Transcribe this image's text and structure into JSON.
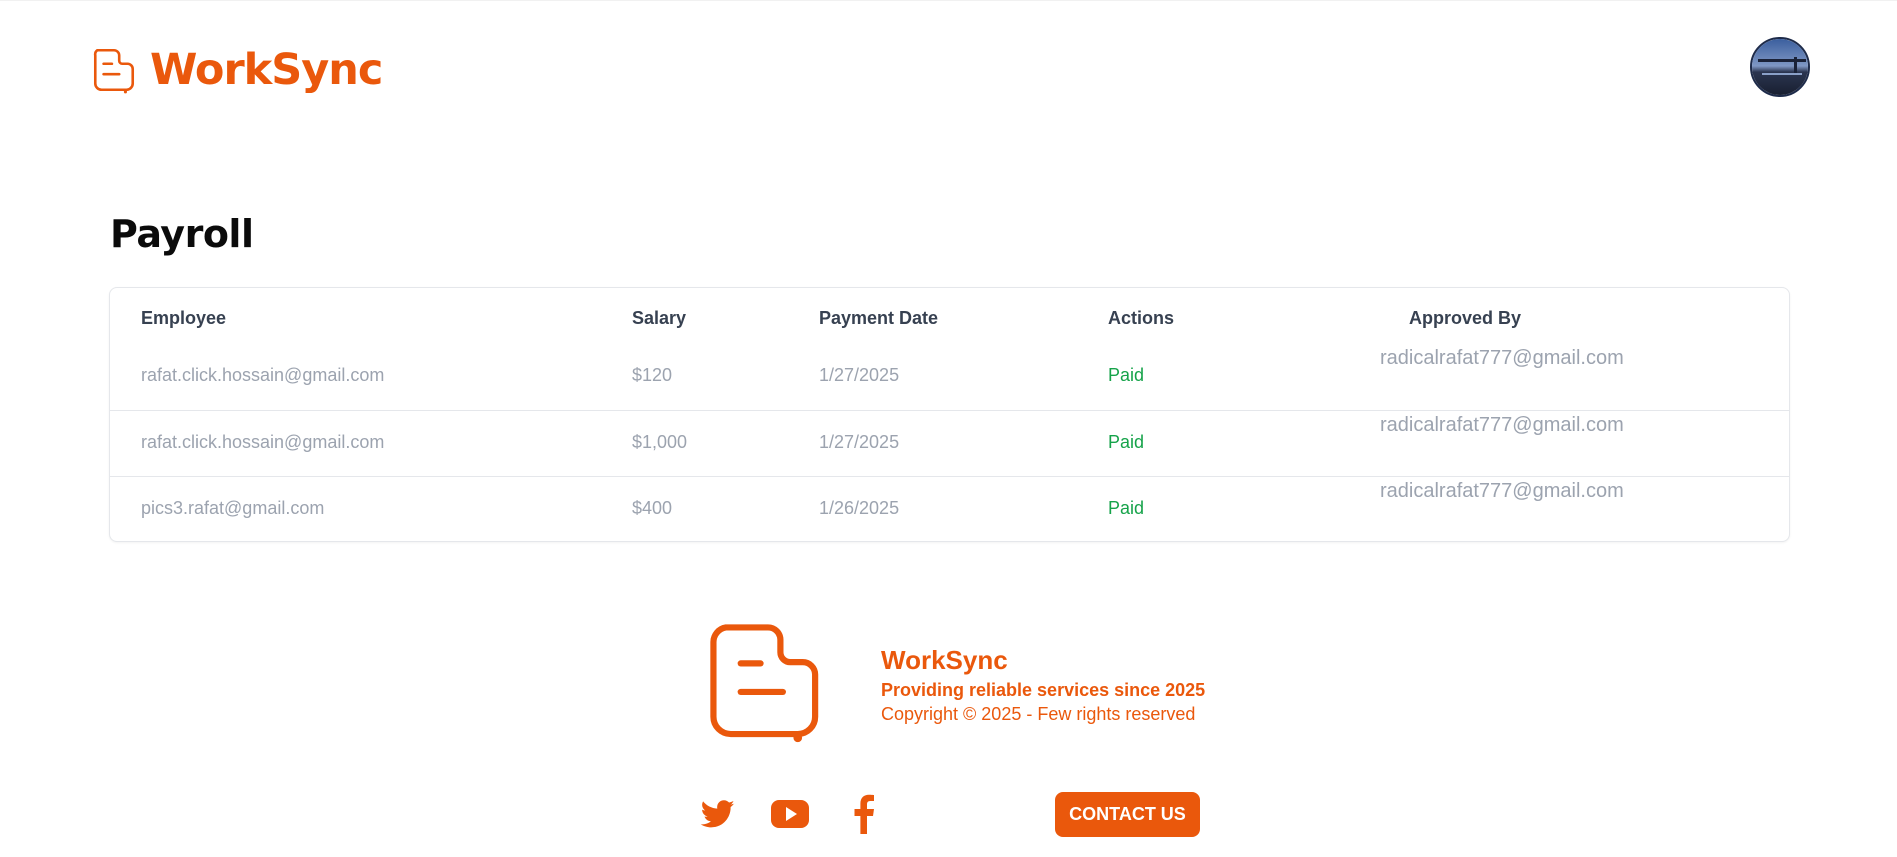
{
  "brand": {
    "name": "WorkSync",
    "accent": "#ea580c"
  },
  "page": {
    "title": "Payroll"
  },
  "table": {
    "headers": {
      "employee": "Employee",
      "salary": "Salary",
      "payment_date": "Payment Date",
      "actions": "Actions",
      "approved_by": "Approved By"
    },
    "rows": [
      {
        "employee": "rafat.click.hossain@gmail.com",
        "salary": "$120",
        "payment_date": "1/27/2025",
        "action": "Paid",
        "approved_by": "radicalrafat777@gmail.com"
      },
      {
        "employee": "rafat.click.hossain@gmail.com",
        "salary": "$1,000",
        "payment_date": "1/27/2025",
        "action": "Paid",
        "approved_by": "radicalrafat777@gmail.com"
      },
      {
        "employee": "pics3.rafat@gmail.com",
        "salary": "$400",
        "payment_date": "1/26/2025",
        "action": "Paid",
        "approved_by": "radicalrafat777@gmail.com"
      }
    ],
    "status_color": "#16a34a"
  },
  "footer": {
    "name": "WorkSync",
    "tagline": "Providing reliable services since 2025",
    "copyright": "Copyright © 2025 - Few rights reserved",
    "social_icons": [
      "twitter-icon",
      "youtube-icon",
      "facebook-icon"
    ],
    "contact_label": "CONTACT US"
  }
}
